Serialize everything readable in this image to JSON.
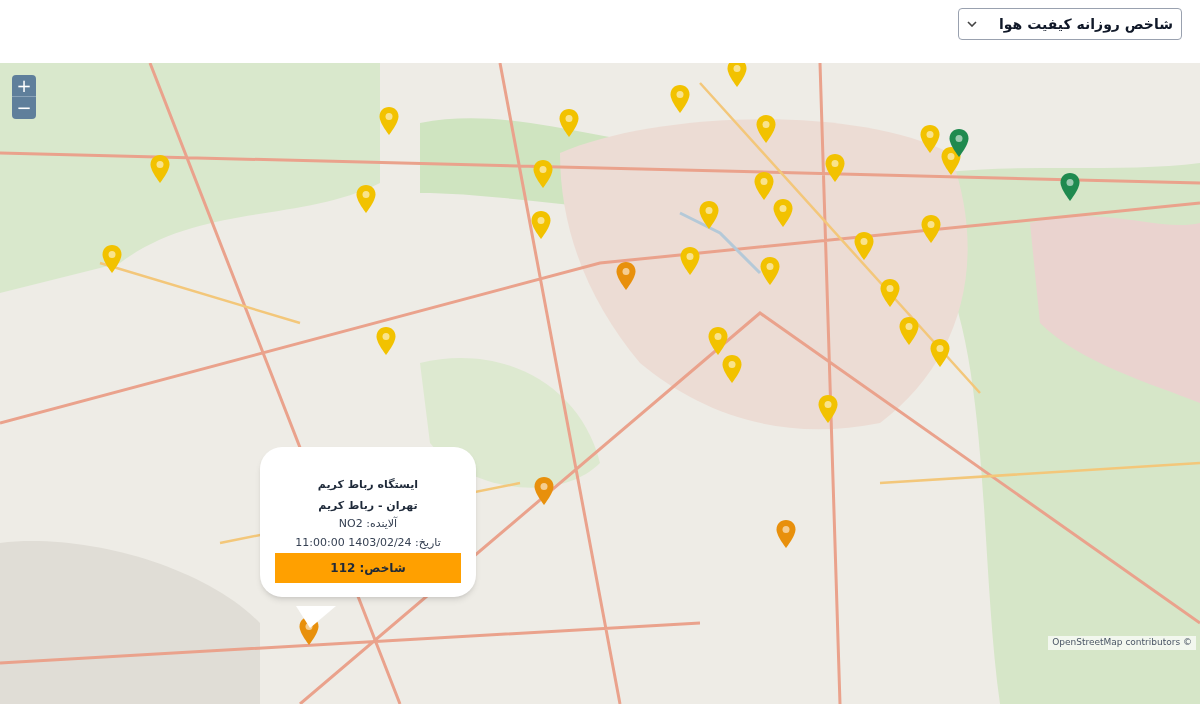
{
  "filter": {
    "value": "شاخص روزانه کیفیت هوا"
  },
  "map": {
    "zoom_in": "+",
    "zoom_out": "−",
    "attribution": "OpenStreetMap contributors ©",
    "markers": [
      {
        "color": "#f2c200"
      },
      {
        "color": "#f2c200"
      },
      {
        "color": "#f2c200"
      },
      {
        "color": "#f2c200"
      },
      {
        "color": "#f2c200"
      },
      {
        "color": "#f2c200"
      },
      {
        "color": "#f2c200"
      },
      {
        "color": "#f2c200"
      },
      {
        "color": "#f2c200"
      },
      {
        "color": "#f2c200"
      },
      {
        "color": "#f2c200"
      },
      {
        "color": "#f2c200"
      },
      {
        "color": "#f2c200"
      },
      {
        "color": "#f2c200"
      },
      {
        "color": "#f2c200"
      },
      {
        "color": "#f2c200"
      },
      {
        "color": "#f2c200"
      },
      {
        "color": "#f2c200"
      },
      {
        "color": "#f2c200"
      },
      {
        "color": "#f2c200"
      },
      {
        "color": "#f2c200"
      },
      {
        "color": "#f2c200"
      },
      {
        "color": "#f2c200"
      },
      {
        "color": "#f2c200"
      },
      {
        "color": "#f2c200"
      },
      {
        "color": "#f2c200"
      },
      {
        "color": "#f2c200"
      },
      {
        "color": "#e8900c"
      },
      {
        "color": "#e8900c"
      },
      {
        "color": "#e8900c"
      },
      {
        "color": "#e8900c"
      },
      {
        "color": "#1f8a4f"
      },
      {
        "color": "#1f8a4f"
      }
    ],
    "popup": {
      "title": "ایستگاه رباط کریم",
      "location": "تهران - رباط کریم",
      "pollutant": "آلاینده: NO2",
      "date": "تاریخ: 1403/02/24 11:00:00",
      "index": "شاخص: 112"
    }
  }
}
